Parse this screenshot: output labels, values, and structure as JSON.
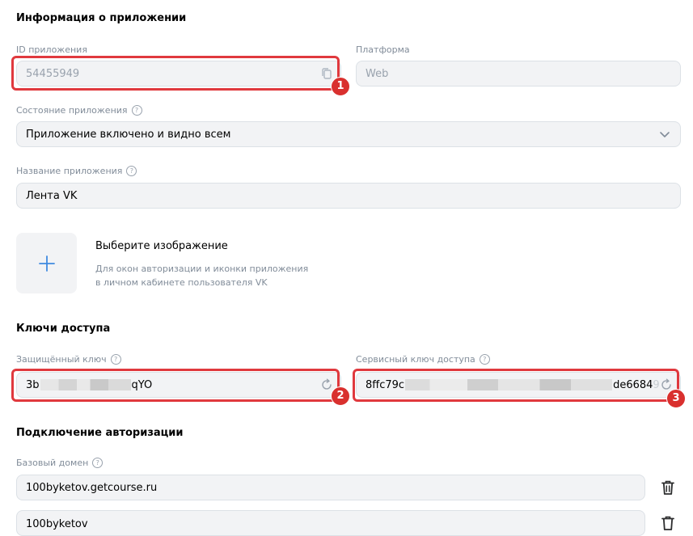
{
  "app_info": {
    "heading": "Информация о приложении",
    "app_id_label": "ID приложения",
    "app_id_value": "54455949",
    "platform_label": "Платформа",
    "platform_value": "Web",
    "state_label": "Состояние приложения",
    "state_value": "Приложение включено и видно всем",
    "name_label": "Название приложения",
    "name_value": "Лента VK",
    "image_title": "Выберите изображение",
    "image_desc_line1": "Для окон авторизации и иконки приложения",
    "image_desc_line2": "в личном кабинете пользователя VK"
  },
  "keys": {
    "heading": "Ключи доступа",
    "secure_label": "Защищённый ключ",
    "secure_prefix": "3b",
    "secure_suffix": "qYO",
    "service_label": "Сервисный ключ доступа",
    "service_prefix": "8ffc79c",
    "service_suffix": "de6684",
    "service_suffix_cut": "9"
  },
  "auth": {
    "heading": "Подключение авторизации",
    "domain_label": "Базовый домен",
    "domain_1": "100byketov.getcourse.ru",
    "domain_2": "100byketov"
  },
  "annotations": {
    "badge_1": "1",
    "badge_2": "2",
    "badge_3": "3",
    "highlight_color": "#e0393e"
  },
  "icons": {
    "copy": "copy-icon",
    "refresh": "refresh-icon",
    "trash": "trash-icon",
    "chevron": "chevron-down-icon",
    "plus": "plus-icon",
    "help": "help-icon"
  }
}
